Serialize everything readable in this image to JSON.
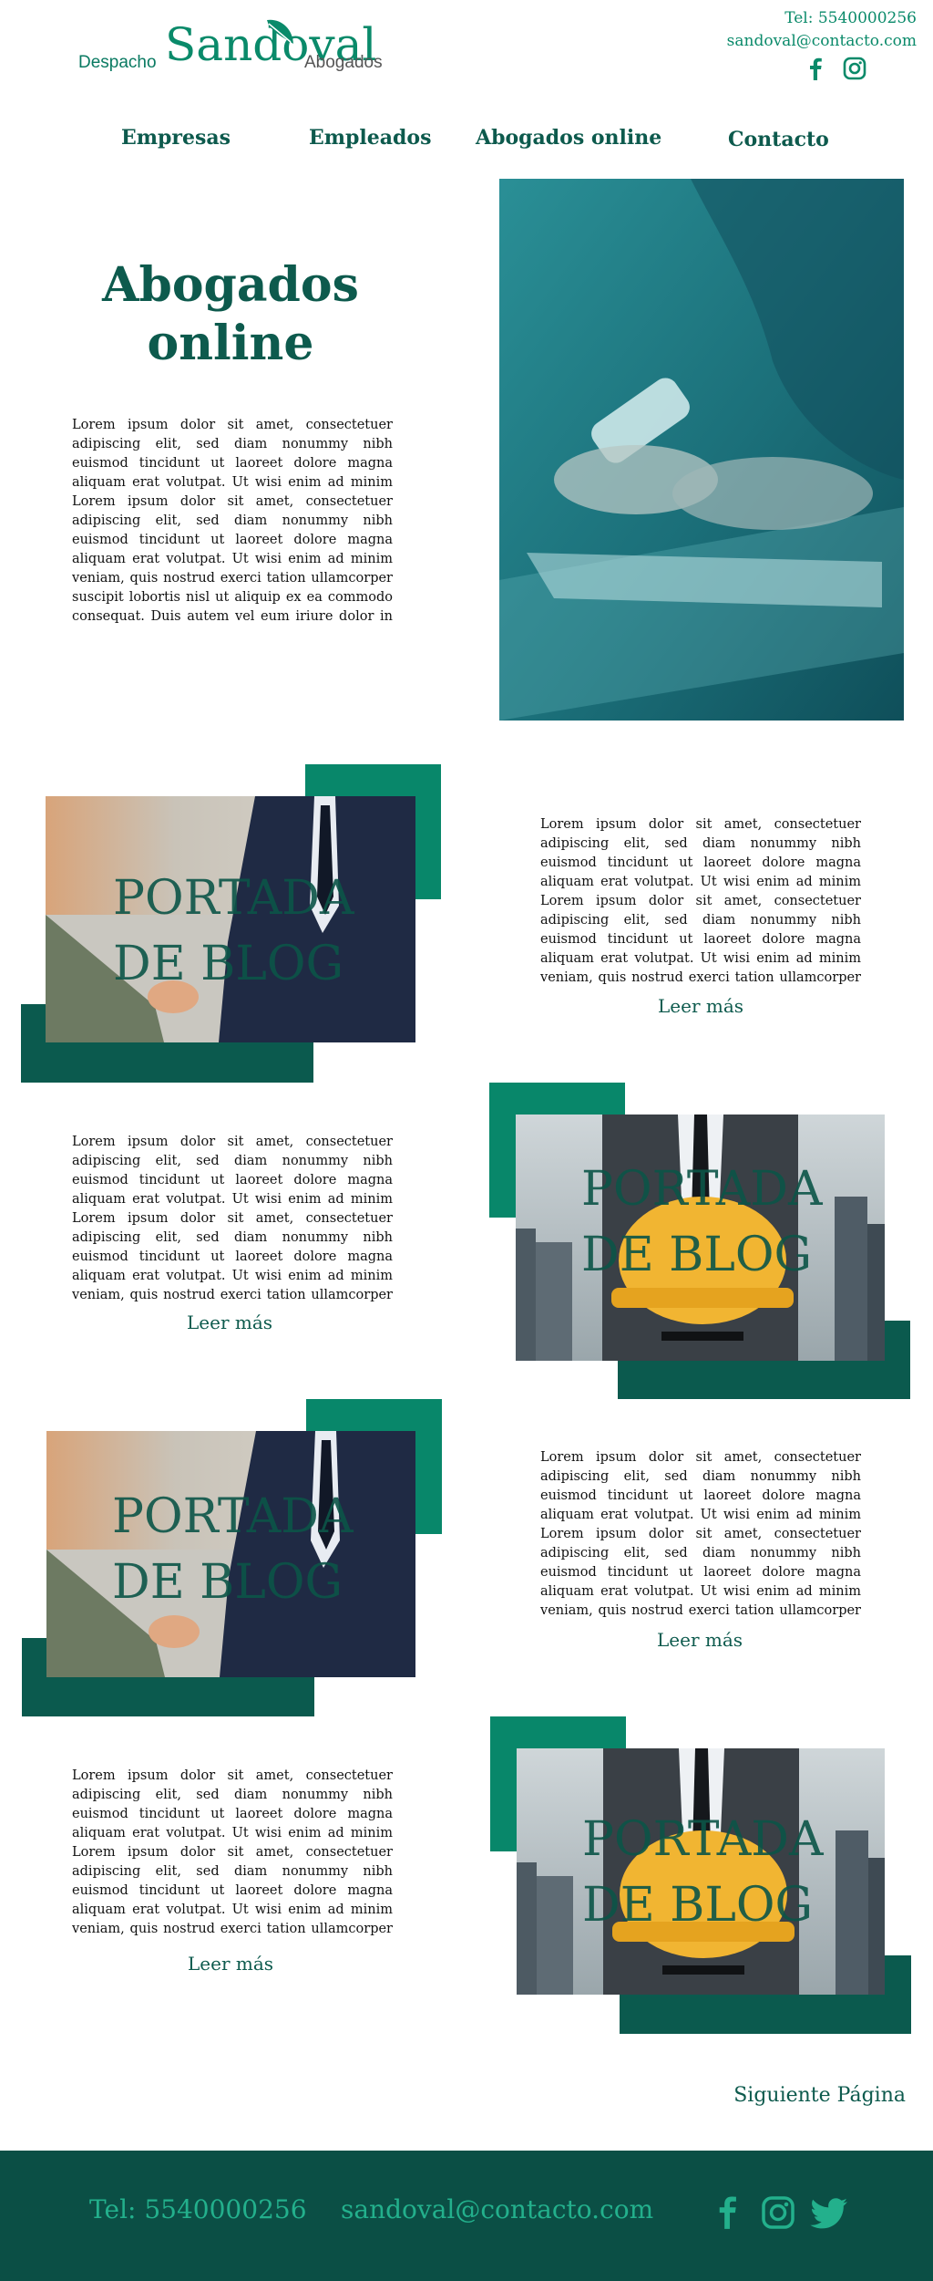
{
  "header": {
    "logo_pre": "Despacho",
    "logo_main": "Sandoval",
    "logo_post": "Abogados",
    "phone": "Tel: 5540000256",
    "email": "sandoval@contacto.com"
  },
  "nav": {
    "items": [
      "Empresas",
      "Empleados",
      "Abogados online",
      "Contacto"
    ]
  },
  "hero": {
    "title_line1": "Abogados",
    "title_line2": "online",
    "paragraph": "Lorem ipsum dolor sit amet, consectetuer adipiscing elit, sed diam nonummy nibh euismod tincidunt ut laoreet dolore magna aliquam erat volutpat. Ut wisi enim ad minim Lorem ipsum dolor sit amet, consectetuer adipiscing elit, sed diam nonummy nibh euismod tincidunt ut laoreet dolore magna aliquam erat volutpat. Ut wisi enim ad minim veniam, quis nostrud exerci tation ullamcorper suscipit lobortis nisl ut aliquip ex ea commodo consequat. Duis autem vel eum iriure dolor in hendrerit in vulputate velit"
  },
  "posts": [
    {
      "overlay_line1": "PORTADA",
      "overlay_line2": "DE BLOG",
      "excerpt": "Lorem ipsum dolor sit amet, consectetuer adipiscing elit, sed diam nonummy nibh euismod tincidunt ut laoreet dolore magna aliquam erat volutpat. Ut wisi enim ad minim Lorem ipsum dolor sit amet, consectetuer adipiscing elit, sed diam nonummy nibh euismod tincidunt ut laoreet dolore magna aliquam erat volutpat. Ut wisi enim ad minim veniam, quis nostrud exerci tation ullamcorper suscipit lobortis nisl ut aliquip",
      "read_more": "Leer más"
    },
    {
      "overlay_line1": "PORTADA",
      "overlay_line2": "DE BLOG",
      "excerpt": "Lorem ipsum dolor sit amet, consectetuer adipiscing elit, sed diam nonummy nibh euismod tincidunt ut laoreet dolore magna aliquam erat volutpat. Ut wisi enim ad minim Lorem ipsum dolor sit amet, consectetuer adipiscing elit, sed diam nonummy nibh euismod tincidunt ut laoreet dolore magna aliquam erat volutpat. Ut wisi enim ad minim veniam, quis nostrud exerci tation ullamcorper suscipit lobortis nisl ut aliquip",
      "read_more": "Leer más"
    },
    {
      "overlay_line1": "PORTADA",
      "overlay_line2": "DE BLOG",
      "excerpt": "Lorem ipsum dolor sit amet, consectetuer adipiscing elit, sed diam nonummy nibh euismod tincidunt ut laoreet dolore magna aliquam erat volutpat. Ut wisi enim ad minim Lorem ipsum dolor sit amet, consectetuer adipiscing elit, sed diam nonummy nibh euismod tincidunt ut laoreet dolore magna aliquam erat volutpat. Ut wisi enim ad minim veniam, quis nostrud exerci tation ullamcorper suscipit lobortis nisl ut aliquip",
      "read_more": "Leer más"
    },
    {
      "overlay_line1": "PORTADA",
      "overlay_line2": "DE BLOG",
      "excerpt": "Lorem ipsum dolor sit amet, consectetuer adipiscing elit, sed diam nonummy nibh euismod tincidunt ut laoreet dolore magna aliquam erat volutpat. Ut wisi enim ad minim Lorem ipsum dolor sit amet, consectetuer adipiscing elit, sed diam nonummy nibh euismod tincidunt ut laoreet dolore magna aliquam erat volutpat. Ut wisi enim ad minim veniam, quis nostrud exerci tation ullamcorper suscipit lobortis nisl ut aliquip",
      "read_more": "Leer más"
    }
  ],
  "pagination": {
    "next_label": "Siguiente Página"
  },
  "footer": {
    "phone": "Tel: 5540000256",
    "email": "sandoval@contacto.com"
  },
  "icons": {
    "header_social": [
      "facebook-icon",
      "instagram-icon"
    ],
    "footer_social": [
      "facebook-icon",
      "instagram-icon",
      "twitter-icon"
    ]
  },
  "colors": {
    "brand_dark": "#0b4f45",
    "brand_green": "#08876a",
    "heading": "#0d5a4d",
    "footer_text": "#23b08c"
  }
}
